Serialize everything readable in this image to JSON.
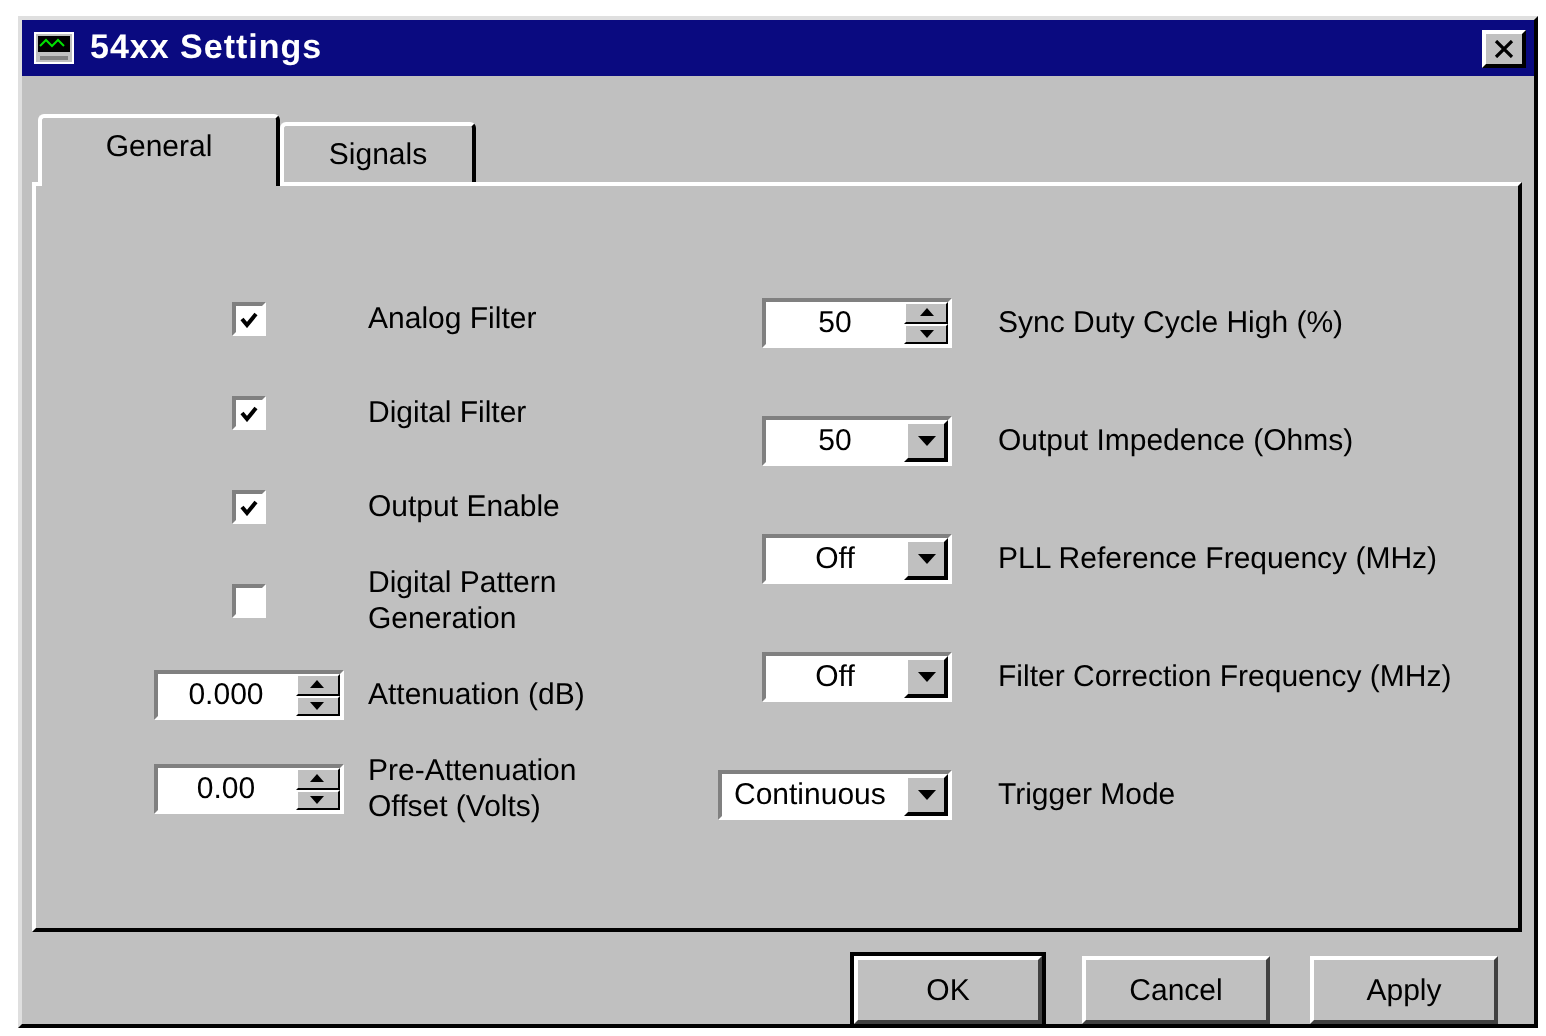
{
  "window": {
    "title": "54xx Settings"
  },
  "tabs": [
    {
      "label": "General",
      "selected": true
    },
    {
      "label": "Signals",
      "selected": false
    }
  ],
  "left_controls": [
    {
      "kind": "checkbox",
      "label": "Analog Filter",
      "checked": true
    },
    {
      "kind": "checkbox",
      "label": "Digital Filter",
      "checked": true
    },
    {
      "kind": "checkbox",
      "label": "Output Enable",
      "checked": true
    },
    {
      "kind": "checkbox",
      "label": "Digital Pattern Generation",
      "checked": false
    },
    {
      "kind": "spin",
      "value": "0.000",
      "label": "Attenuation (dB)"
    },
    {
      "kind": "spin",
      "value": "0.00",
      "label": "Pre-Attenuation Offset (Volts)"
    }
  ],
  "right_controls": [
    {
      "kind": "spin",
      "value": "50",
      "label": "Sync Duty Cycle High (%)"
    },
    {
      "kind": "dropdown",
      "value": "50",
      "label": "Output Impedence (Ohms)"
    },
    {
      "kind": "dropdown",
      "value": "Off",
      "label": "PLL Reference Frequency (MHz)"
    },
    {
      "kind": "dropdown",
      "value": "Off",
      "label": "Filter Correction Frequency (MHz)"
    },
    {
      "kind": "dropdown",
      "value": "Continuous",
      "label": "Trigger Mode"
    }
  ],
  "buttons": [
    {
      "label": "OK",
      "default": true
    },
    {
      "label": "Cancel",
      "default": false
    },
    {
      "label": "Apply",
      "default": false
    }
  ]
}
